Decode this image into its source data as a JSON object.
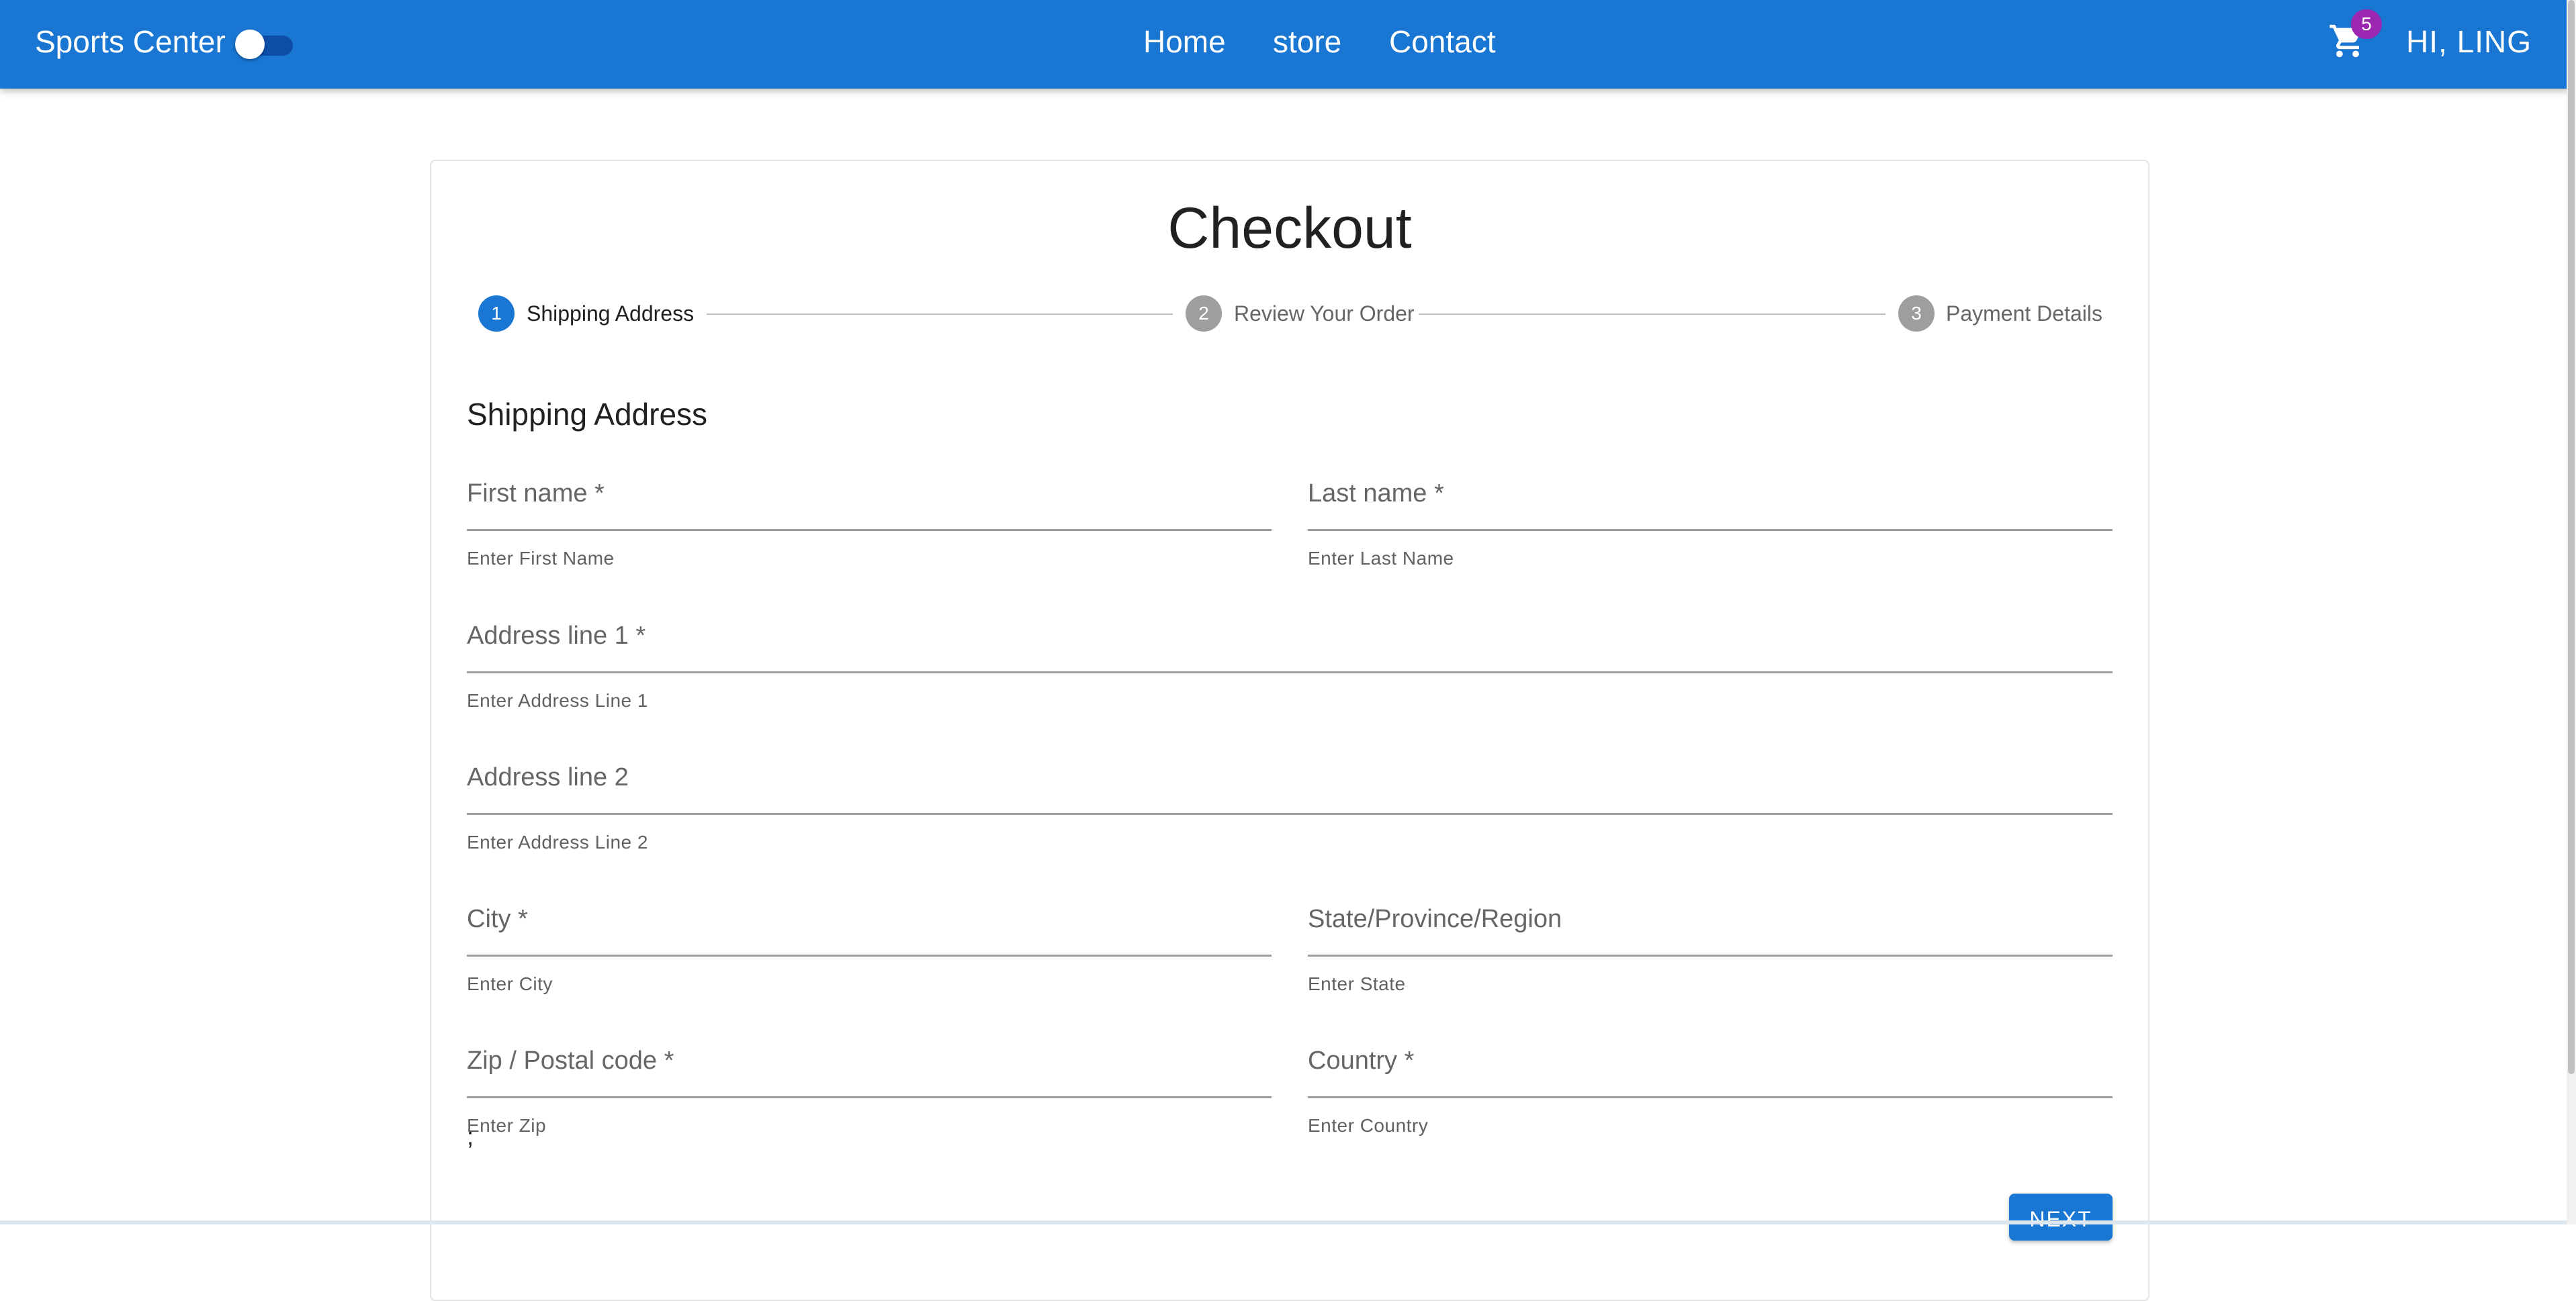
{
  "appbar": {
    "brand": "Sports Center",
    "nav": [
      "Home",
      "store",
      "Contact"
    ],
    "cart_count": "5",
    "greeting": "HI, LING",
    "color": "#1976d2"
  },
  "checkout": {
    "title": "Checkout",
    "steps": [
      {
        "number": "1",
        "label": "Shipping Address",
        "active": true
      },
      {
        "number": "2",
        "label": "Review Your Order",
        "active": false
      },
      {
        "number": "3",
        "label": "Payment Details",
        "active": false
      }
    ],
    "section_title": "Shipping Address",
    "fields": {
      "first_name": {
        "label": "First name *",
        "helper": "Enter First Name",
        "value": ""
      },
      "last_name": {
        "label": "Last name *",
        "helper": "Enter Last Name",
        "value": ""
      },
      "address1": {
        "label": "Address line 1 *",
        "helper": "Enter Address Line 1",
        "value": ""
      },
      "address2": {
        "label": "Address line 2",
        "helper": "Enter Address Line 2",
        "value": ""
      },
      "city": {
        "label": "City *",
        "helper": "Enter City",
        "value": ""
      },
      "state": {
        "label": "State/Province/Region",
        "helper": "Enter State",
        "value": ""
      },
      "zip": {
        "label": "Zip / Postal code *",
        "helper": "Enter Zip",
        "value": ""
      },
      "country": {
        "label": "Country *",
        "helper": "Enter Country",
        "value": ""
      }
    },
    "stray_text": ";",
    "next_label": "NEXT"
  },
  "colors": {
    "primary": "#1976d2",
    "inactive_step": "#9e9e9e",
    "badge": "#9c27b0"
  }
}
